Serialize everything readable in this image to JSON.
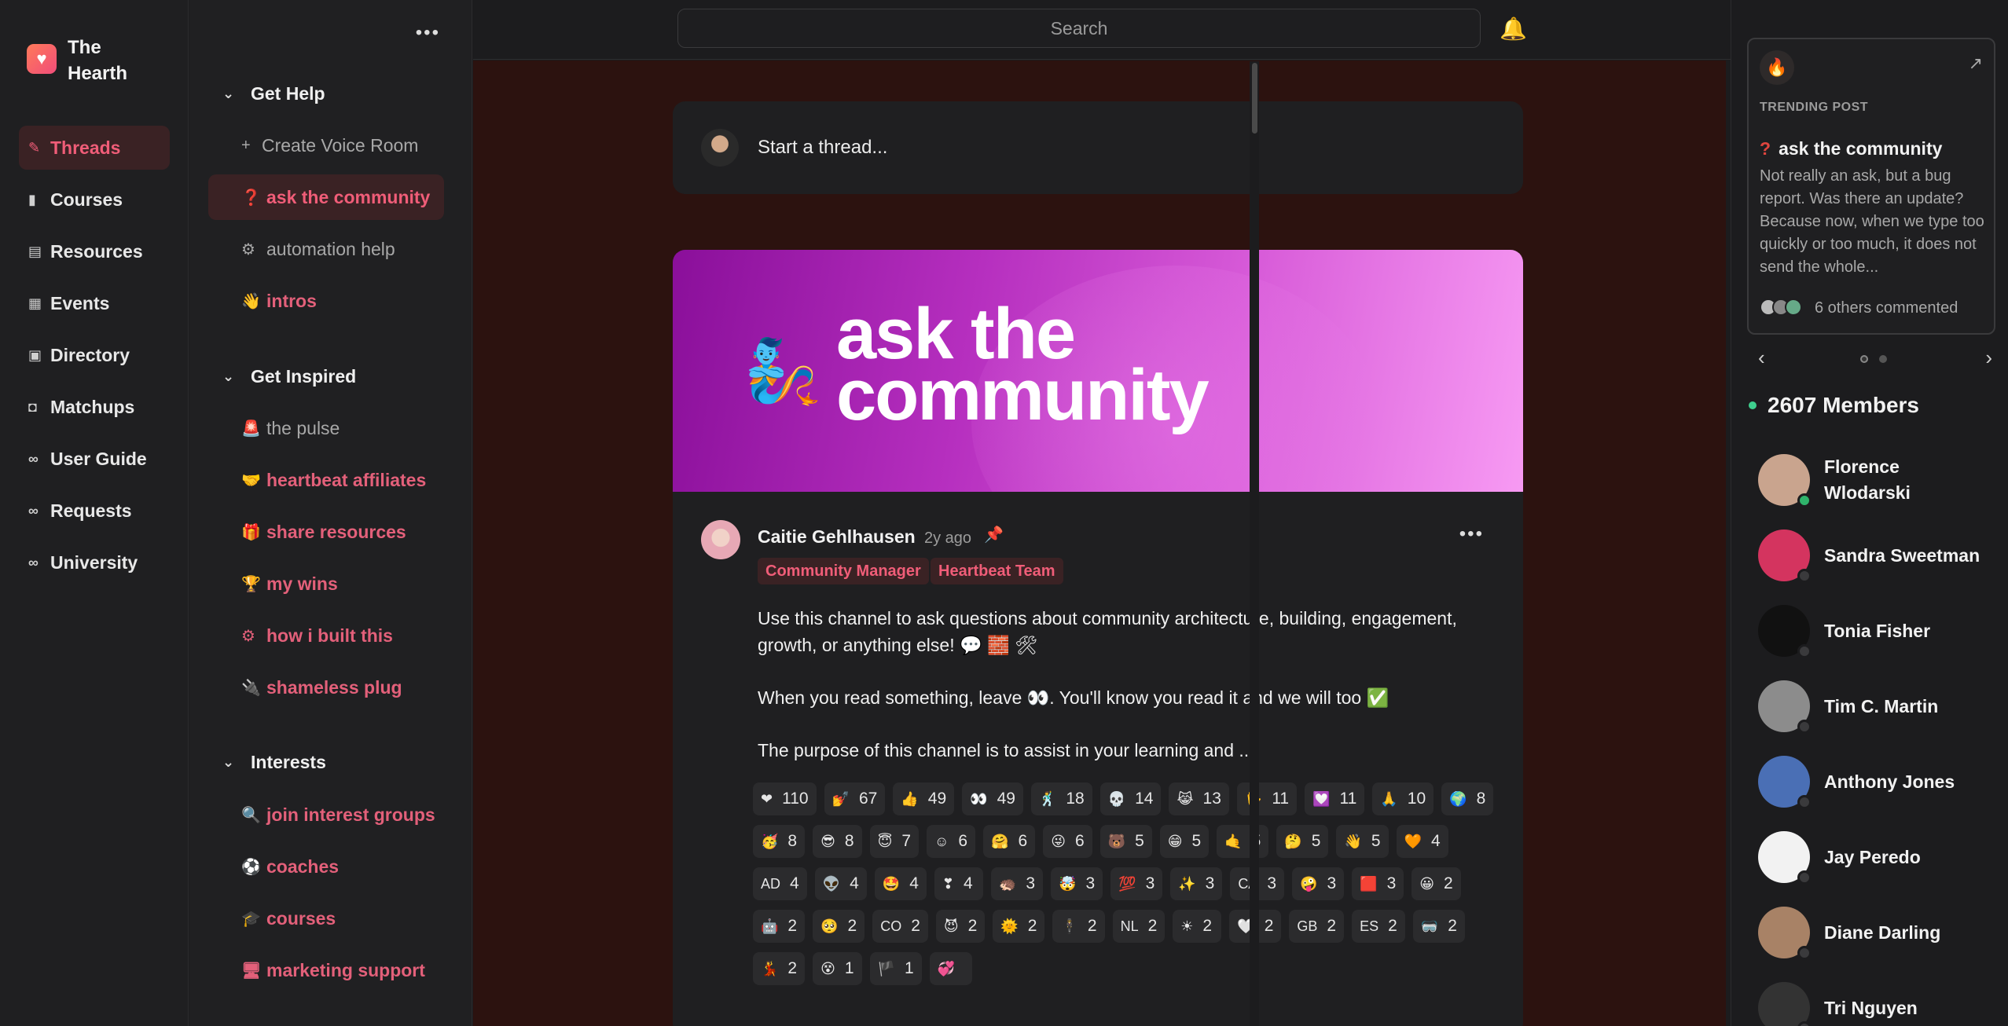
{
  "brand": {
    "name": "The Hearth",
    "logo_icon": "heart-logo-icon"
  },
  "nav": {
    "items": [
      {
        "label": "Threads",
        "icon": "quill-icon",
        "active": true
      },
      {
        "label": "Courses",
        "icon": "book-icon"
      },
      {
        "label": "Resources",
        "icon": "document-icon"
      },
      {
        "label": "Events",
        "icon": "calendar-icon"
      },
      {
        "label": "Directory",
        "icon": "contact-book-icon"
      },
      {
        "label": "Matchups",
        "icon": "mug-icon"
      },
      {
        "label": "User Guide",
        "icon": "link-icon"
      },
      {
        "label": "Requests",
        "icon": "link-icon"
      },
      {
        "label": "University",
        "icon": "link-icon"
      }
    ]
  },
  "channels": {
    "more_label": "•••",
    "groups": {
      "help": "Get Help",
      "inspired": "Get Inspired",
      "interests": "Interests"
    },
    "items": [
      {
        "label": "Create Voice Room",
        "emoji": "+"
      },
      {
        "label": "ask the community",
        "emoji": "❓"
      },
      {
        "label": "automation help",
        "emoji": "⚙"
      },
      {
        "label": "intros",
        "emoji": "👋"
      },
      {
        "label": "the pulse",
        "emoji": "🚨"
      },
      {
        "label": "heartbeat affiliates",
        "emoji": "🤝"
      },
      {
        "label": "share resources",
        "emoji": "🎁"
      },
      {
        "label": "my wins",
        "emoji": "🏆"
      },
      {
        "label": "how i built this",
        "emoji": "⚙"
      },
      {
        "label": "shameless plug",
        "emoji": "🔌"
      },
      {
        "label": "join interest groups",
        "emoji": "🔍"
      },
      {
        "label": "coaches",
        "emoji": "⚽"
      },
      {
        "label": "courses",
        "emoji": "🎓"
      },
      {
        "label": "marketing support",
        "emoji": "🖥"
      }
    ]
  },
  "topbar": {
    "search_placeholder": "Search",
    "bell_icon": "bell-icon"
  },
  "composer": {
    "placeholder": "Start a thread..."
  },
  "post": {
    "banner_title_line1": "ask the",
    "banner_title_line2": "community",
    "banner_emoji": "🧞",
    "author": "Caitie Gehlhausen",
    "time": "2y ago",
    "more_label": "•••",
    "tags": [
      "Community Manager",
      "Heartbeat Team"
    ],
    "paragraphs": [
      "Use this channel to ask questions about community architecture, building, engagement, growth, or anything else! 💬 🧱 🛠",
      "When you read something, leave 👀. You'll know you read it and we will too ✅",
      "The purpose of this channel is to assist in your learning and ..."
    ],
    "reactions": [
      {
        "e": "❤",
        "n": "110"
      },
      {
        "e": "💅",
        "n": "67"
      },
      {
        "e": "👍",
        "n": "49"
      },
      {
        "e": "👀",
        "n": "49"
      },
      {
        "e": "🕺",
        "n": "18"
      },
      {
        "e": "💀",
        "n": "14"
      },
      {
        "e": "😹",
        "n": "13"
      },
      {
        "e": "🖖",
        "n": "11"
      },
      {
        "e": "💟",
        "n": "11"
      },
      {
        "e": "🙏",
        "n": "10"
      },
      {
        "e": "🌍",
        "n": "8"
      },
      {
        "e": "🥳",
        "n": "8"
      },
      {
        "e": "😎",
        "n": "8"
      },
      {
        "e": "😇",
        "n": "7"
      },
      {
        "e": "☺",
        "n": "6"
      },
      {
        "e": "🤗",
        "n": "6"
      },
      {
        "e": "😜",
        "n": "6"
      },
      {
        "e": "🐻",
        "n": "5"
      },
      {
        "e": "😁",
        "n": "5"
      },
      {
        "e": "🤙",
        "n": "5"
      },
      {
        "e": "🤔",
        "n": "5"
      },
      {
        "e": "👋",
        "n": "5"
      },
      {
        "e": "🧡",
        "n": "4"
      },
      {
        "e": "AD",
        "n": "4"
      },
      {
        "e": "👽",
        "n": "4"
      },
      {
        "e": "🤩",
        "n": "4"
      },
      {
        "e": "❣",
        "n": "4"
      },
      {
        "e": "🦔",
        "n": "3"
      },
      {
        "e": "🤯",
        "n": "3"
      },
      {
        "e": "💯",
        "n": "3"
      },
      {
        "e": "✨",
        "n": "3"
      },
      {
        "e": "CA",
        "n": "3"
      },
      {
        "e": "🤪",
        "n": "3"
      },
      {
        "e": "🟥",
        "n": "3"
      },
      {
        "e": "😀",
        "n": "2"
      },
      {
        "e": "🤖",
        "n": "2"
      },
      {
        "e": "🥺",
        "n": "2"
      },
      {
        "e": "CO",
        "n": "2"
      },
      {
        "e": "😈",
        "n": "2"
      },
      {
        "e": "🌞",
        "n": "2"
      },
      {
        "e": "🕴",
        "n": "2"
      },
      {
        "e": "NL",
        "n": "2"
      },
      {
        "e": "☀",
        "n": "2"
      },
      {
        "e": "🤍",
        "n": "2"
      },
      {
        "e": "GB",
        "n": "2"
      },
      {
        "e": "ES",
        "n": "2"
      },
      {
        "e": "🥽",
        "n": "2"
      },
      {
        "e": "💃",
        "n": "2"
      },
      {
        "e": "😵",
        "n": "1"
      },
      {
        "e": "🏴",
        "n": "1"
      },
      {
        "e": "💞",
        "n": ""
      }
    ]
  },
  "trending": {
    "label": "TRENDING POST",
    "title": "ask the community",
    "text": "Not really an ask, but a bug report. Was there an update? Because now, when we type too quickly or too much, it does not send the whole...",
    "comments": "6 others commented"
  },
  "members": {
    "count_label": "2607 Members",
    "list": [
      {
        "name": "Florence Wlodarski",
        "color": "#c9a48e",
        "online": true
      },
      {
        "name": "Sandra Sweetman",
        "color": "#d4345f",
        "online": false
      },
      {
        "name": "Tonia Fisher",
        "color": "#111111",
        "online": false
      },
      {
        "name": "Tim C. Martin",
        "color": "#8c8c8c",
        "online": false
      },
      {
        "name": "Anthony Jones",
        "color": "#4a6fb5",
        "online": false
      },
      {
        "name": "Jay Peredo",
        "color": "#f2f2f2",
        "online": false
      },
      {
        "name": "Diane Darling",
        "color": "#a88266",
        "online": false
      },
      {
        "name": "Tri Nguyen",
        "color": "#333333",
        "online": false
      }
    ]
  }
}
